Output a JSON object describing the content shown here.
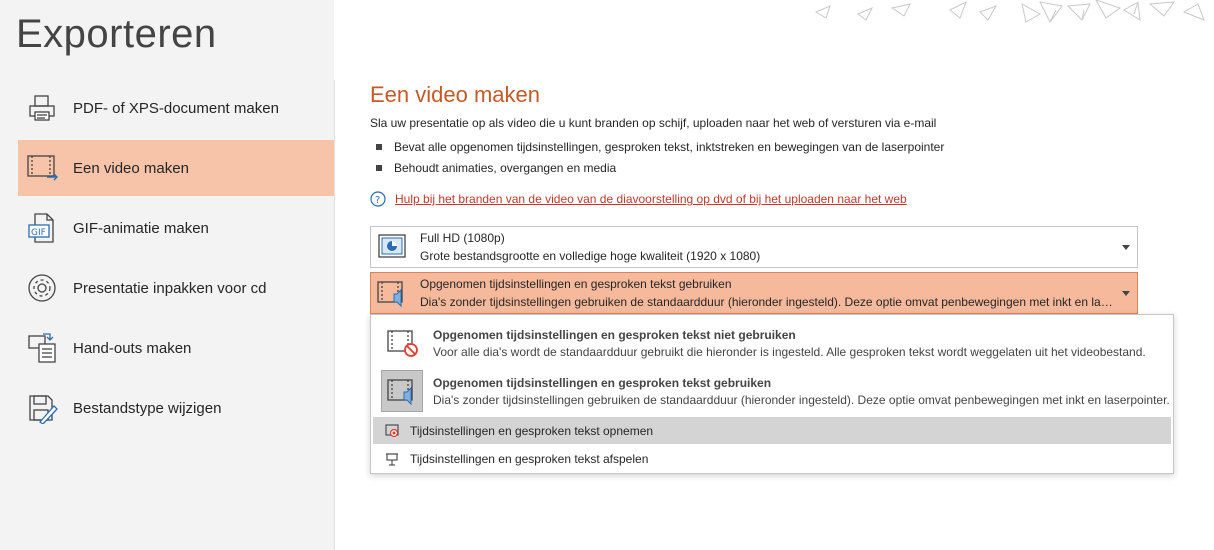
{
  "page": {
    "title": "Exporteren"
  },
  "nav": {
    "items": [
      {
        "label": "PDF- of XPS-document maken",
        "icon": "pdf-document-icon"
      },
      {
        "label": "Een video maken",
        "icon": "video-icon",
        "selected": true
      },
      {
        "label": "GIF-animatie maken",
        "icon": "gif-icon"
      },
      {
        "label": "Presentatie inpakken voor cd",
        "icon": "cd-icon"
      },
      {
        "label": "Hand-outs maken",
        "icon": "handouts-icon"
      },
      {
        "label": "Bestandstype wijzigen",
        "icon": "change-file-type-icon"
      }
    ]
  },
  "main": {
    "title": "Een video maken",
    "description": "Sla uw presentatie op als video die u kunt branden op schijf, uploaden naar het web of versturen via e-mail",
    "bullets": [
      "Bevat alle opgenomen tijdsinstellingen, gesproken tekst, inktstreken en bewegingen van de laserpointer",
      "Behoudt animaties, overgangen en media"
    ],
    "help_link": "Hulp bij het branden van de video van de diavoorstelling op dvd of bij het uploaden naar het web"
  },
  "quality_dropdown": {
    "title": "Full HD (1080p)",
    "subtitle": "Grote bestandsgrootte en volledige hoge kwaliteit (1920 x 1080)"
  },
  "timing_dropdown": {
    "title": "Opgenomen tijdsinstellingen en gesproken tekst gebruiken",
    "subtitle": "Dia's zonder tijdsinstellingen gebruiken de standaardduur (hieronder ingesteld). Deze optie omvat penbewegingen met inkt en laserpointer."
  },
  "menu": {
    "options": [
      {
        "title": "Opgenomen tijdsinstellingen en gesproken tekst niet gebruiken",
        "subtitle": "Voor alle dia's wordt de standaardduur gebruikt die hieronder is ingesteld. Alle gesproken tekst wordt weggelaten uit het videobestand."
      },
      {
        "title": "Opgenomen tijdsinstellingen en gesproken tekst gebruiken",
        "subtitle": "Dia's zonder tijdsinstellingen gebruiken de standaardduur (hieronder ingesteld). Deze optie omvat penbewegingen met inkt en laserpointer."
      }
    ],
    "commands": [
      "Tijdsinstellingen en gesproken tekst opnemen",
      "Tijdsinstellingen en gesproken tekst afspelen"
    ]
  },
  "colors": {
    "accent": "#c55a28",
    "selected": "#f8c4a9",
    "active_dropdown": "#f6b99c",
    "link": "#c0392b"
  }
}
